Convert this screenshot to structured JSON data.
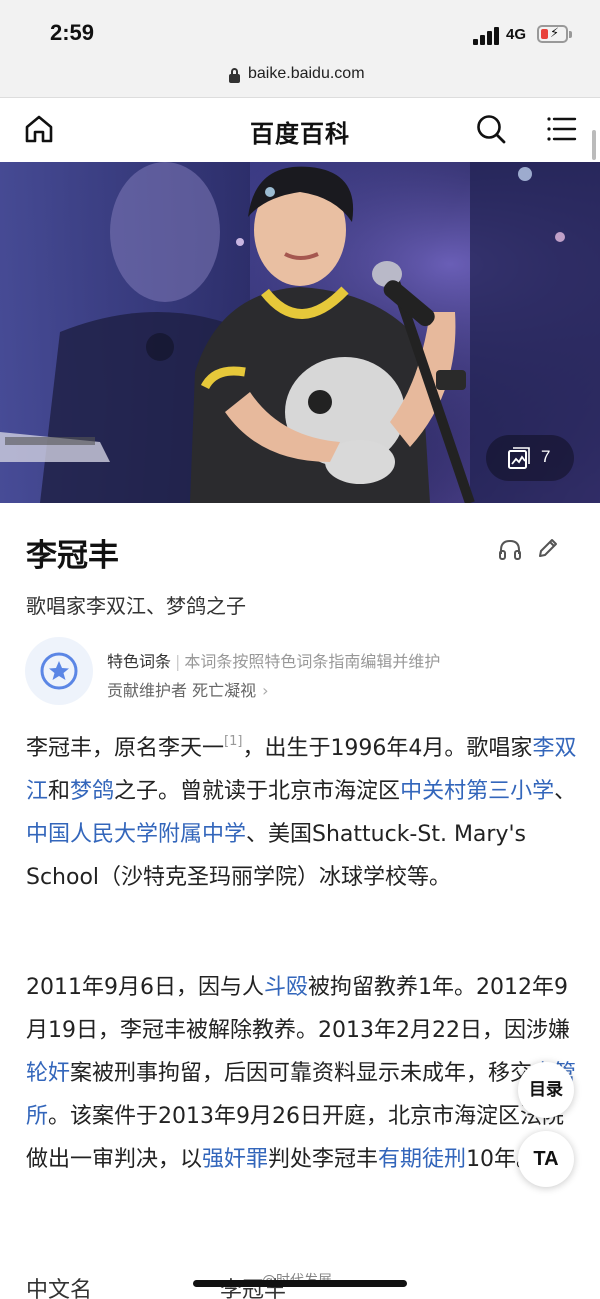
{
  "status_bar": {
    "time": "2:59",
    "network": "4G"
  },
  "browser": {
    "url": "baike.baidu.com"
  },
  "header": {
    "title": "百度百科"
  },
  "hero": {
    "photo_count": "7"
  },
  "entry": {
    "title": "李冠丰",
    "subtitle": "歌唱家李双江、梦鸽之子"
  },
  "featured": {
    "label": "特色词条",
    "description": "本词条按照特色词条指南编辑并维护",
    "maintainer_label": "贡献维护者 死亡凝视"
  },
  "paragraph1": {
    "t1": "李冠丰，原名李天一",
    "ref": "[1]",
    "t2": "，出生于1996年4月。歌唱家",
    "link1": "李双江",
    "t3": "和",
    "link2": "梦鸽",
    "t4": "之子。曾就读于北京市海淀区",
    "link3": "中关村第三小学",
    "t5": "、",
    "link4": "中国人民大学附属中学",
    "t6": "、美国Shattuck-St. Mary's School（沙特克圣玛丽学院）冰球学校等。"
  },
  "paragraph2": {
    "t1": "2011年9月6日，因与人",
    "link1": "斗殴",
    "t2": "被拘留教养1年。2012年9月19日，李冠丰被解除教养。2013年2月22日，因涉嫌",
    "link2": "轮奸",
    "t3": "案被刑事拘留，后因可靠资料显示未成年，移交",
    "link3": "少管所",
    "t4": "。该案件于2013年9月26日开庭，北京市海淀区法院做出一审判决，以",
    "link4": "强奸罪",
    "t5": "判处李冠丰",
    "link5": "有期徒刑",
    "t6": "10年。"
  },
  "infobox": {
    "label": "中文名",
    "value": "李冠丰"
  },
  "fabs": {
    "toc": "目录",
    "ta": "TA"
  },
  "watermark": "@时代发展",
  "colors": {
    "link": "#3366bb",
    "battery_low": "#e8423a"
  }
}
